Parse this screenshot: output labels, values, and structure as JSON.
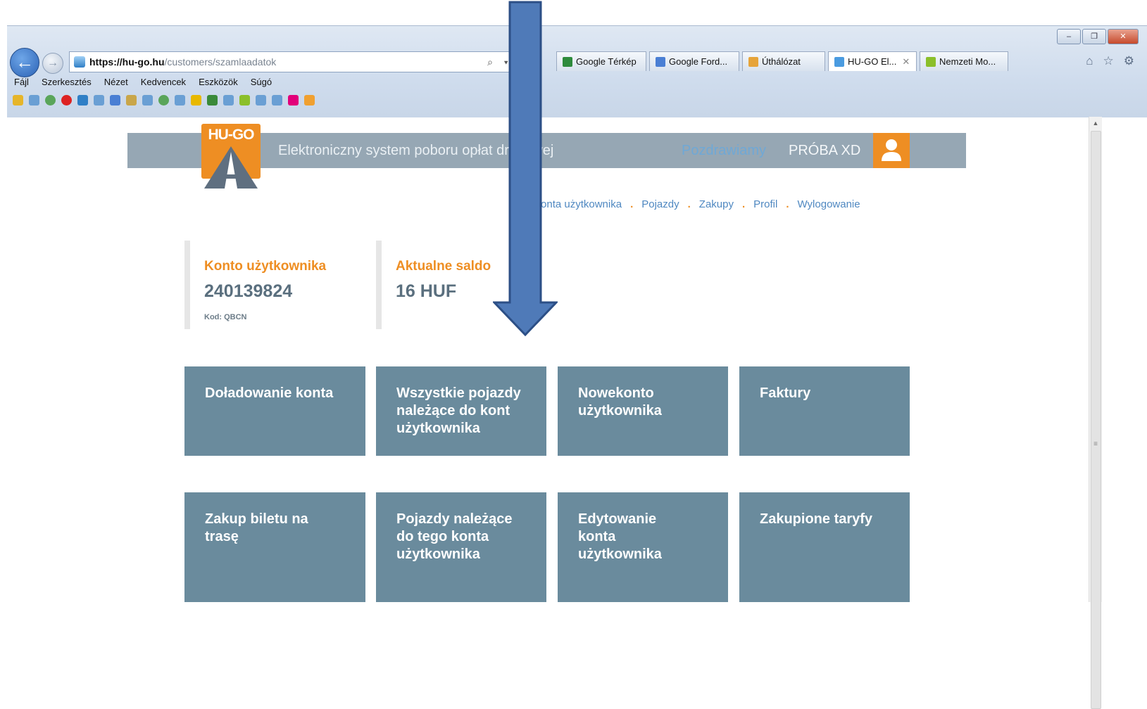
{
  "browser": {
    "url_host": "https://hu-go.hu",
    "url_path": "/customers/szamlaadatok",
    "url_tools": "⌕ ▾ 🔒",
    "tabs": [
      {
        "label": "Google Térkép",
        "color": "#2e8b3c",
        "active": false
      },
      {
        "label": "Google Ford...",
        "color": "#4a7fd4",
        "active": false
      },
      {
        "label": "Úthálózat",
        "color": "#e6a43a",
        "active": false
      },
      {
        "label": "HU-GO El...",
        "color": "#4a9be0",
        "active": true
      },
      {
        "label": "Nemzeti Mo...",
        "color": "#8bbf2a",
        "active": false
      }
    ],
    "menu": [
      "Fájl",
      "Szerkesztés",
      "Nézet",
      "Kedvencek",
      "Eszközök",
      "Súgó"
    ],
    "window_buttons": [
      "–",
      "❐",
      "✕"
    ],
    "nav_icons": [
      "⌂",
      "☆",
      "⚙"
    ],
    "back_icon": "←",
    "forward_icon": "→"
  },
  "header": {
    "logo_text": "HU-GO",
    "subtitle": "Elektroniczny system poboru opłat drogowej",
    "greeting": "Pozdrawiamy",
    "user_name": "PRÓBA XD"
  },
  "nav": {
    "items": [
      "Konta użytkownika",
      "Pojazdy",
      "Zakupy",
      "Profil",
      "Wylogowanie"
    ]
  },
  "account": {
    "label": "Konto użytkownika",
    "number": "240139824",
    "code": "Kod: QBCN"
  },
  "balance": {
    "label": "Aktualne saldo",
    "value": "16 HUF"
  },
  "tiles": [
    "Doładowanie konta",
    "Wszystkie pojazdy należące do kont użytkownika",
    "Nowekonto użytkownika",
    "Faktury",
    "Zakup biletu na trasę",
    "Pojazdy należące do tego konta użytkownika",
    "Edytowanie konta użytkownika",
    "Zakupione taryfy"
  ],
  "colors": {
    "accent_orange": "#ee8e23",
    "tile_blue": "#6a8b9d",
    "link_blue": "#4f88c1",
    "annotation_arrow": "#4f7ab8"
  }
}
